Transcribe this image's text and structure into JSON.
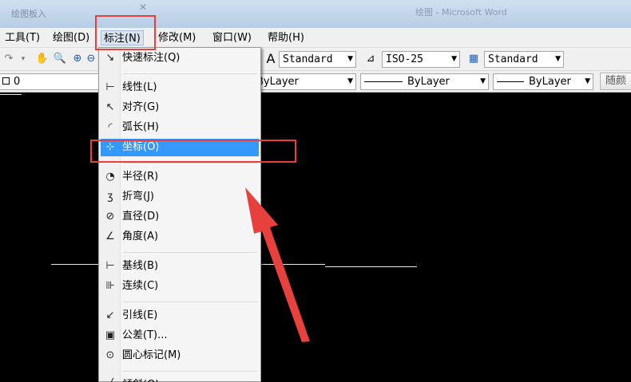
{
  "window": {
    "title": "绘图板入",
    "title_right": "绘图 - Microsoft Word"
  },
  "menubar": {
    "items": [
      {
        "label": "工具(T)"
      },
      {
        "label": "绘图(D)"
      },
      {
        "label": "标注(N)"
      },
      {
        "label": "修改(M)"
      },
      {
        "label": "窗口(W)"
      },
      {
        "label": "帮助(H)"
      }
    ]
  },
  "toolbar": {
    "text_style": "Standard",
    "dim_style": "ISO-25",
    "table_style": "Standard",
    "layer": "0",
    "color": "ByLayer",
    "linetype": "ByLayer",
    "lineweight": "ByLayer",
    "plot_style": "随颜"
  },
  "dimension_menu": {
    "items": [
      {
        "label": "快速标注(Q)",
        "icon": "quick-dimension-icon",
        "glyph": "↘"
      },
      {
        "sep": true
      },
      {
        "label": "线性(L)",
        "icon": "linear-dimension-icon",
        "glyph": "⊢"
      },
      {
        "label": "对齐(G)",
        "icon": "aligned-dimension-icon",
        "glyph": "↖"
      },
      {
        "label": "弧长(H)",
        "icon": "arc-length-icon",
        "glyph": "◜"
      },
      {
        "label": "坐标(O)",
        "icon": "ordinate-dimension-icon",
        "glyph": "⊹",
        "selected": true
      },
      {
        "sep": true
      },
      {
        "label": "半径(R)",
        "icon": "radius-dimension-icon",
        "glyph": "◔"
      },
      {
        "label": "折弯(J)",
        "icon": "jogged-dimension-icon",
        "glyph": "ʒ"
      },
      {
        "label": "直径(D)",
        "icon": "diameter-dimension-icon",
        "glyph": "⊘"
      },
      {
        "label": "角度(A)",
        "icon": "angular-dimension-icon",
        "glyph": "∠"
      },
      {
        "sep": true
      },
      {
        "label": "基线(B)",
        "icon": "baseline-dimension-icon",
        "glyph": "⊢"
      },
      {
        "label": "连续(C)",
        "icon": "continue-dimension-icon",
        "glyph": "⊪"
      },
      {
        "sep": true
      },
      {
        "label": "引线(E)",
        "icon": "leader-icon",
        "glyph": "↙"
      },
      {
        "label": "公差(T)...",
        "icon": "tolerance-icon",
        "glyph": "▣"
      },
      {
        "label": "圆心标记(M)",
        "icon": "center-mark-icon",
        "glyph": "⊙"
      },
      {
        "sep": true
      },
      {
        "label": "倾斜(Q)",
        "icon": "oblique-icon",
        "glyph": "╱"
      }
    ]
  },
  "colors": {
    "highlight_box": "#e8403c",
    "arrow": "#e8403c",
    "selection": "#3399ff"
  }
}
